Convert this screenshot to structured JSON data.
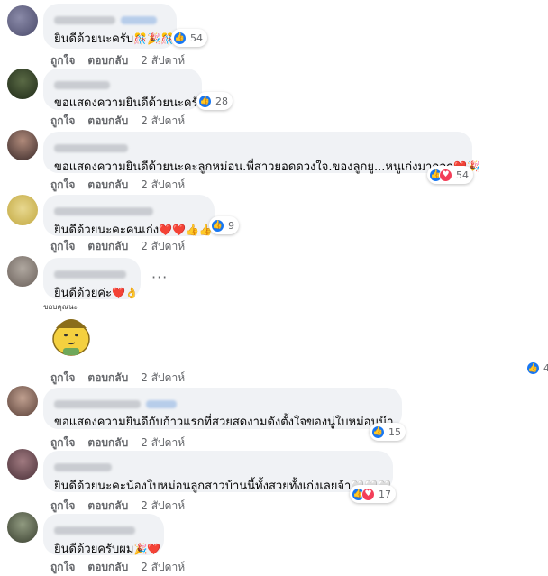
{
  "comments": [
    {
      "text": "ยินดีด้วยนะครับ",
      "emoji": "🎊🎉🎊",
      "reactions": [
        "like"
      ],
      "count": "54"
    },
    {
      "text": "ขอแสดงความยินดีด้วยนะครับ",
      "emoji": "",
      "reactions": [
        "like"
      ],
      "count": "28"
    },
    {
      "text": "ขอแสดงความยินดีด้วยนะคะลูกหม่อน.พี่สาวยอดดวงใจ.ของลูกยู...หนูเก่งมากลูก",
      "emoji": "❤️🎉",
      "reactions": [
        "like",
        "love"
      ],
      "count": "54"
    },
    {
      "text": "ยินดีด้วยนะคะคนเก่ง",
      "emoji": "❤️❤️👍👍",
      "reactions": [
        "like"
      ],
      "count": "9"
    },
    {
      "text": "ยินดีด้วยค่ะ",
      "emoji": "❤️👌",
      "reactions": [],
      "count": ""
    },
    {
      "text": "ขอแสดงความยินดีกับก้าวแรกที่สวยสดงามดังตั้งใจของนู่ใบหม่อนน๊า",
      "emoji": "",
      "reactions": [
        "like"
      ],
      "count": "15"
    },
    {
      "text": "ยินดีด้วยนะคะน้องใบหม่อนลูกสาวบ้านนี้ทั้งสวยทั้งเก่งเลยจ้า",
      "emoji": "🤍🤍🤍",
      "reactions": [
        "like",
        "love"
      ],
      "count": "17"
    },
    {
      "text": "ยินดีด้วยครับผม",
      "emoji": "🎉❤️",
      "reactions": [],
      "count": ""
    }
  ],
  "actions": {
    "like": "ถูกใจ",
    "reply": "ตอบกลับ",
    "time": "2 สัปดาห์"
  },
  "sticker": {
    "caption": "ขอบคุณนะ",
    "reaction_count": "4"
  },
  "more_options": "···",
  "colors": {
    "like": "#1877f2",
    "love": "#f33e58",
    "bubble": "#f0f2f5",
    "meta": "#65676b"
  }
}
